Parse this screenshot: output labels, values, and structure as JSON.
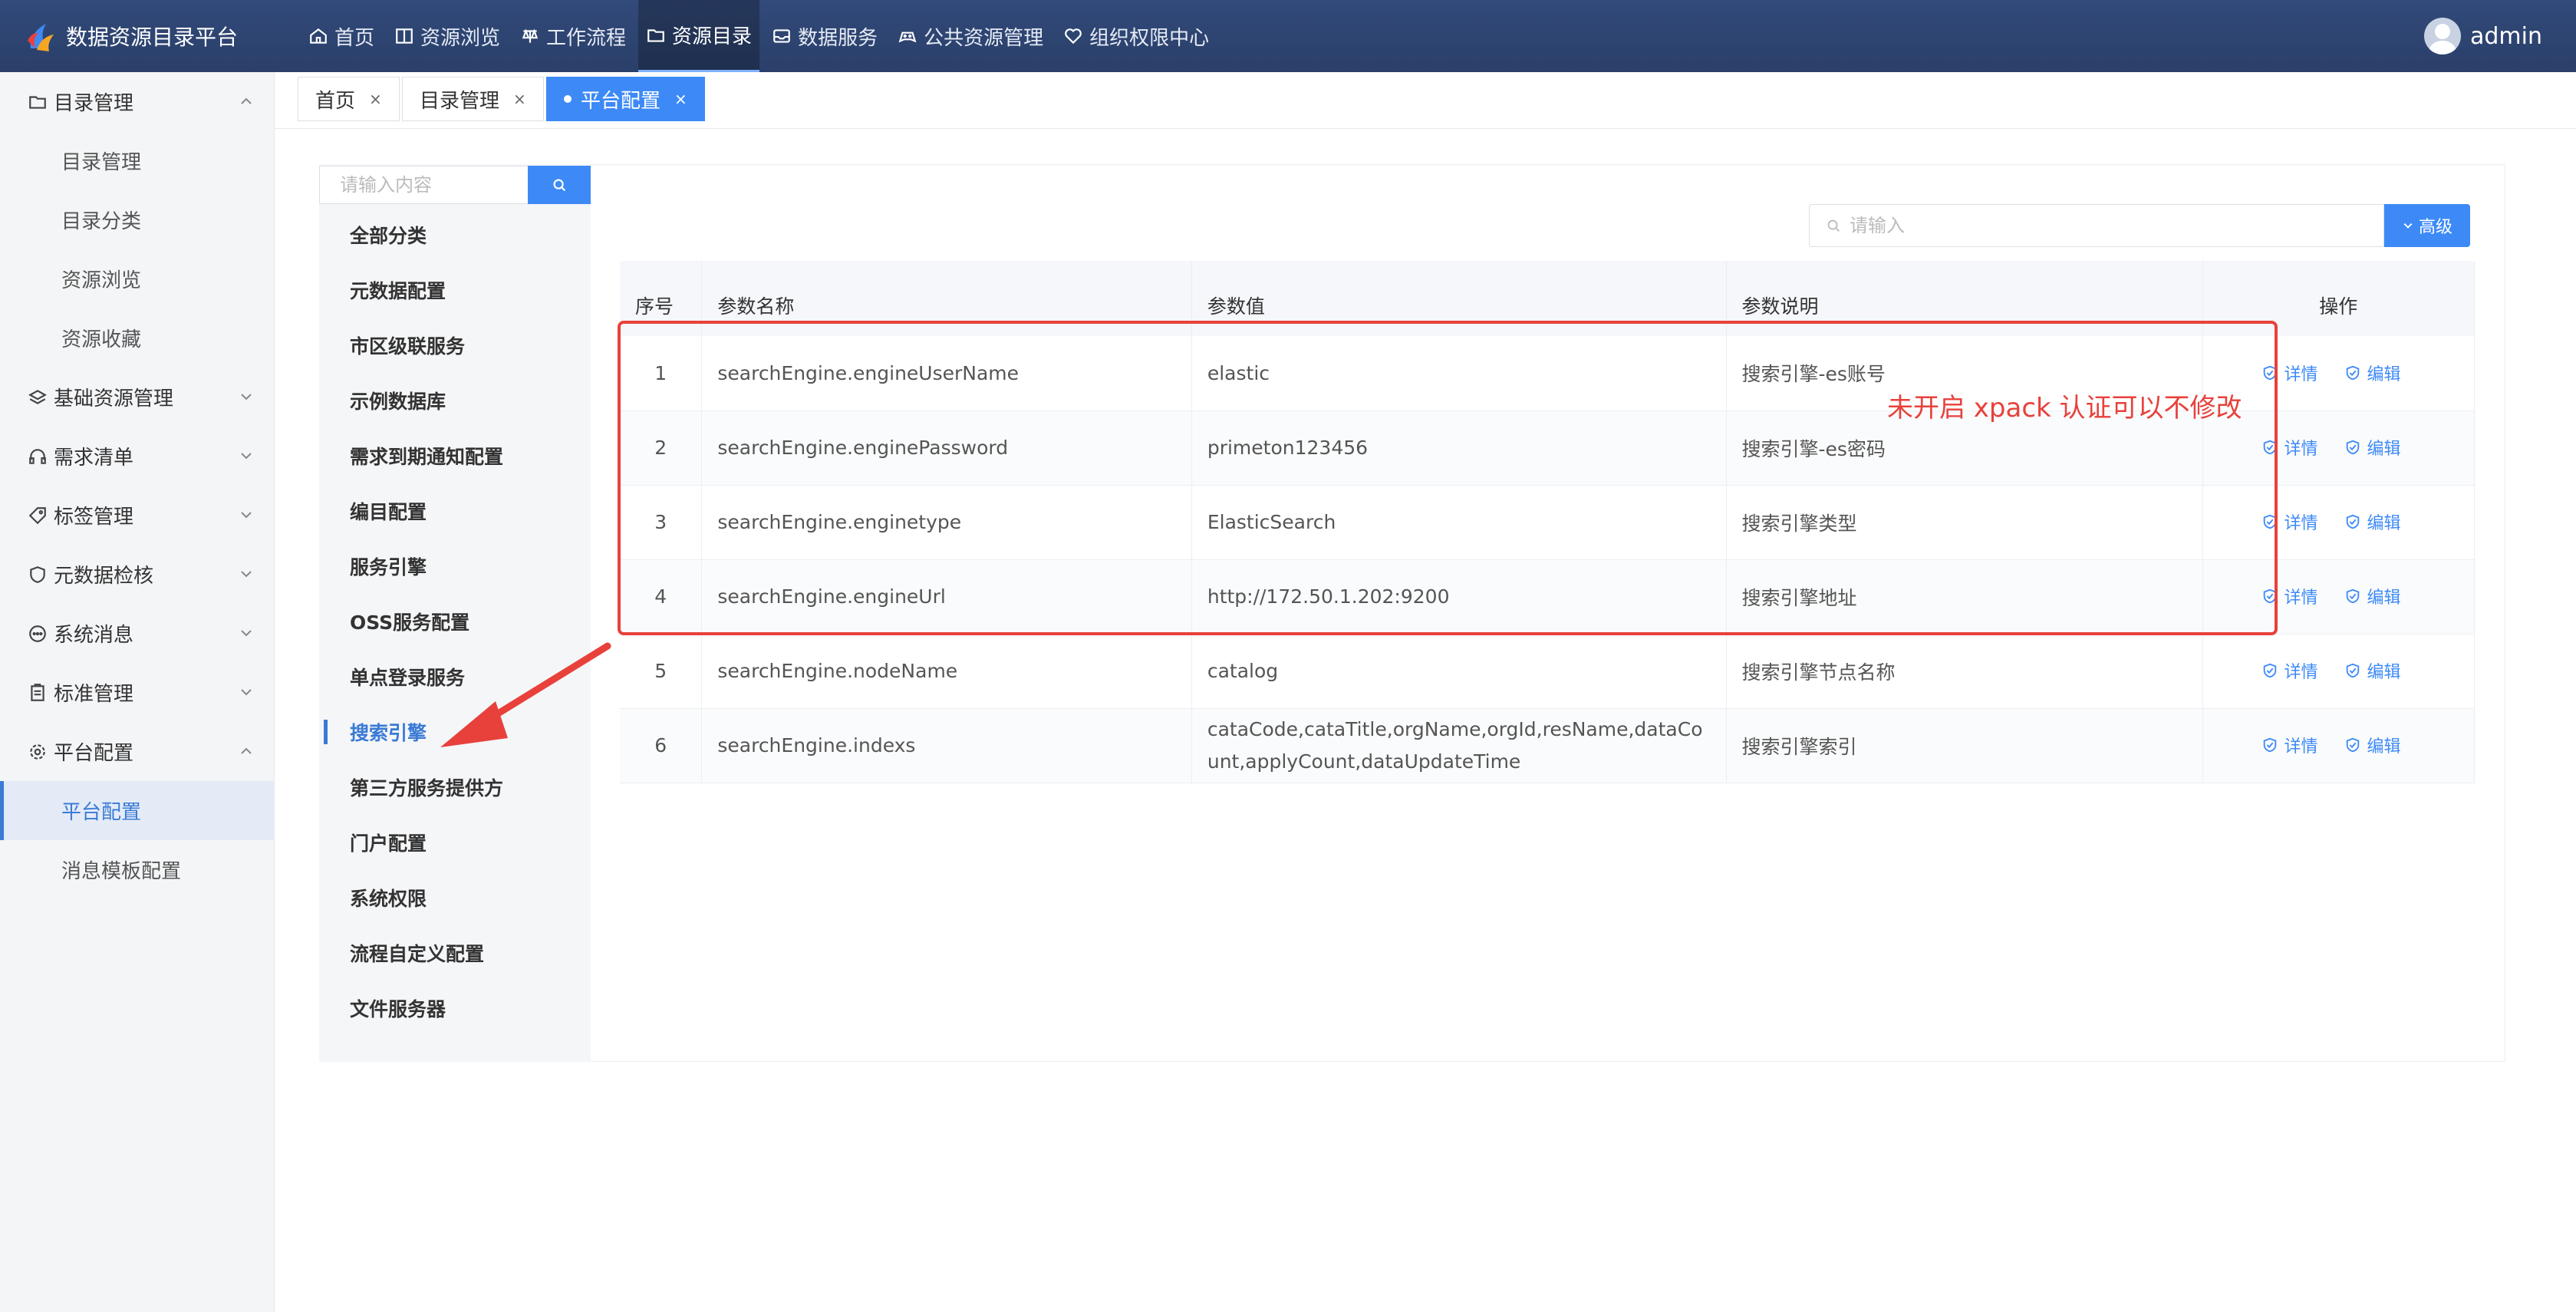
{
  "app": {
    "title": "数据资源目录平台"
  },
  "topnav": [
    {
      "label": "首页",
      "icon": "home-icon"
    },
    {
      "label": "资源浏览",
      "icon": "book-icon"
    },
    {
      "label": "工作流程",
      "icon": "flow-icon"
    },
    {
      "label": "资源目录",
      "icon": "folder-icon"
    },
    {
      "label": "数据服务",
      "icon": "inbox-icon"
    },
    {
      "label": "公共资源管理",
      "icon": "gamepad-icon"
    },
    {
      "label": "组织权限中心",
      "icon": "heart-icon"
    }
  ],
  "user": {
    "name": "admin"
  },
  "sidebar": {
    "groups": [
      {
        "label": "目录管理",
        "icon": "folder-icon",
        "expanded": true
      },
      {
        "label": "基础资源管理",
        "icon": "layers-icon"
      },
      {
        "label": "需求清单",
        "icon": "headset-icon"
      },
      {
        "label": "标签管理",
        "icon": "tag-icon"
      },
      {
        "label": "元数据检核",
        "icon": "shield-icon"
      },
      {
        "label": "系统消息",
        "icon": "message-icon"
      },
      {
        "label": "标准管理",
        "icon": "clipboard-icon"
      },
      {
        "label": "平台配置",
        "icon": "gear-icon",
        "expanded": true
      }
    ],
    "directory_items": [
      "目录管理",
      "目录分类",
      "资源浏览",
      "资源收藏"
    ],
    "platform_items": [
      "平台配置",
      "消息模板配置"
    ]
  },
  "tabs": [
    {
      "label": "首页"
    },
    {
      "label": "目录管理"
    },
    {
      "label": "平台配置",
      "active": true
    }
  ],
  "category": {
    "search_placeholder": "请输入内容",
    "items": [
      "全部分类",
      "元数据配置",
      "市区级联服务",
      "示例数据库",
      "需求到期通知配置",
      "编目配置",
      "服务引擎",
      "OSS服务配置",
      "单点登录服务",
      "搜索引擎",
      "第三方服务提供方",
      "门户配置",
      "系统权限",
      "流程自定义配置",
      "文件服务器"
    ],
    "active": "搜索引擎"
  },
  "search": {
    "placeholder": "请输入",
    "advanced_label": "高级"
  },
  "table": {
    "headers": [
      "序号",
      "参数名称",
      "参数值",
      "参数说明",
      "操作"
    ],
    "rows": [
      {
        "idx": "1",
        "name": "searchEngine.engineUserName",
        "value": "elastic",
        "desc": "搜索引擎-es账号"
      },
      {
        "idx": "2",
        "name": "searchEngine.enginePassword",
        "value": "primeton123456",
        "desc": "搜索引擎-es密码"
      },
      {
        "idx": "3",
        "name": "searchEngine.enginetype",
        "value": "ElasticSearch",
        "desc": "搜索引擎类型"
      },
      {
        "idx": "4",
        "name": "searchEngine.engineUrl",
        "value": "http://172.50.1.202:9200",
        "desc": "搜索引擎地址"
      },
      {
        "idx": "5",
        "name": "searchEngine.nodeName",
        "value": "catalog",
        "desc": "搜索引擎节点名称"
      },
      {
        "idx": "6",
        "name": "searchEngine.indexs",
        "value": "cataCode,cataTitle,orgName,orgId,resName,dataCount,applyCount,dataUpdateTime",
        "value_line1": "cataCode,cataTitle,orgName,orgId,resName,dataCo",
        "value_line2": "unt,applyCount,dataUpdateTime",
        "desc": "搜索引擎索引"
      }
    ],
    "op_detail": "详情",
    "op_edit": "编辑"
  },
  "annotation": {
    "text": "未开启 xpack 认证可以不修改",
    "color": "#e8413b"
  },
  "colors": {
    "accent": "#3d8af7",
    "topbar": "#2f456f",
    "annotation": "#e8413b"
  }
}
